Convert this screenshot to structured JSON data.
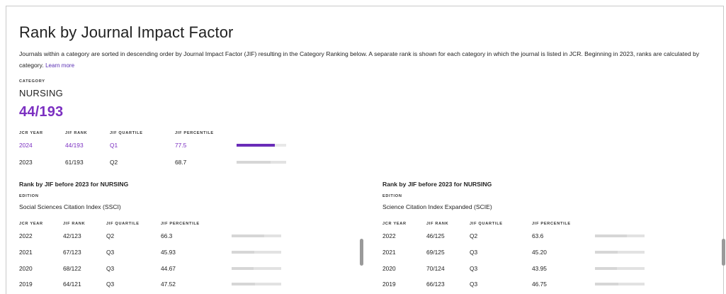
{
  "title": "Rank by Journal Impact Factor",
  "description": "Journals within a category are sorted in descending order by Journal Impact Factor (JIF) resulting in the Category Ranking below. A separate rank is shown for each category in which the journal is listed in JCR. Beginning in 2023, ranks are calculated by category.",
  "learn_more": "Learn more",
  "category_label": "CATEGORY",
  "category_name": "NURSING",
  "current_rank": "44/193",
  "columns": {
    "year": "JCR YEAR",
    "rank": "JIF RANK",
    "quartile": "JIF QUARTILE",
    "percentile": "JIF PERCENTILE"
  },
  "main_rows": [
    {
      "year": "2024",
      "rank": "44/193",
      "quartile": "Q1",
      "percentile": "77.5",
      "percent": 77.5,
      "highlight": true
    },
    {
      "year": "2023",
      "rank": "61/193",
      "quartile": "Q2",
      "percentile": "68.7",
      "percent": 68.7,
      "highlight": false
    }
  ],
  "edition_label": "EDITION",
  "panels": [
    {
      "title": "Rank by JIF before 2023 for NURSING",
      "edition": "Social Sciences Citation Index (SSCI)",
      "rows": [
        {
          "year": "2022",
          "rank": "42/123",
          "quartile": "Q2",
          "percentile": "66.3",
          "percent": 66.3
        },
        {
          "year": "2021",
          "rank": "67/123",
          "quartile": "Q3",
          "percentile": "45.93",
          "percent": 45.93
        },
        {
          "year": "2020",
          "rank": "68/122",
          "quartile": "Q3",
          "percentile": "44.67",
          "percent": 44.67
        },
        {
          "year": "2019",
          "rank": "64/121",
          "quartile": "Q3",
          "percentile": "47.52",
          "percent": 47.52
        }
      ]
    },
    {
      "title": "Rank by JIF before 2023 for NURSING",
      "edition": "Science Citation Index Expanded (SCIE)",
      "rows": [
        {
          "year": "2022",
          "rank": "46/125",
          "quartile": "Q2",
          "percentile": "63.6",
          "percent": 63.6
        },
        {
          "year": "2021",
          "rank": "69/125",
          "quartile": "Q3",
          "percentile": "45.20",
          "percent": 45.2
        },
        {
          "year": "2020",
          "rank": "70/124",
          "quartile": "Q3",
          "percentile": "43.95",
          "percent": 43.95
        },
        {
          "year": "2019",
          "rank": "66/123",
          "quartile": "Q3",
          "percentile": "46.75",
          "percent": 46.75
        }
      ]
    }
  ],
  "colors": {
    "accent": "#7b2fc1",
    "bar_fill_highlight": "#6a2cb8",
    "bar_fill": "#d6d6d6",
    "bar_track": "#e2e2e2"
  }
}
